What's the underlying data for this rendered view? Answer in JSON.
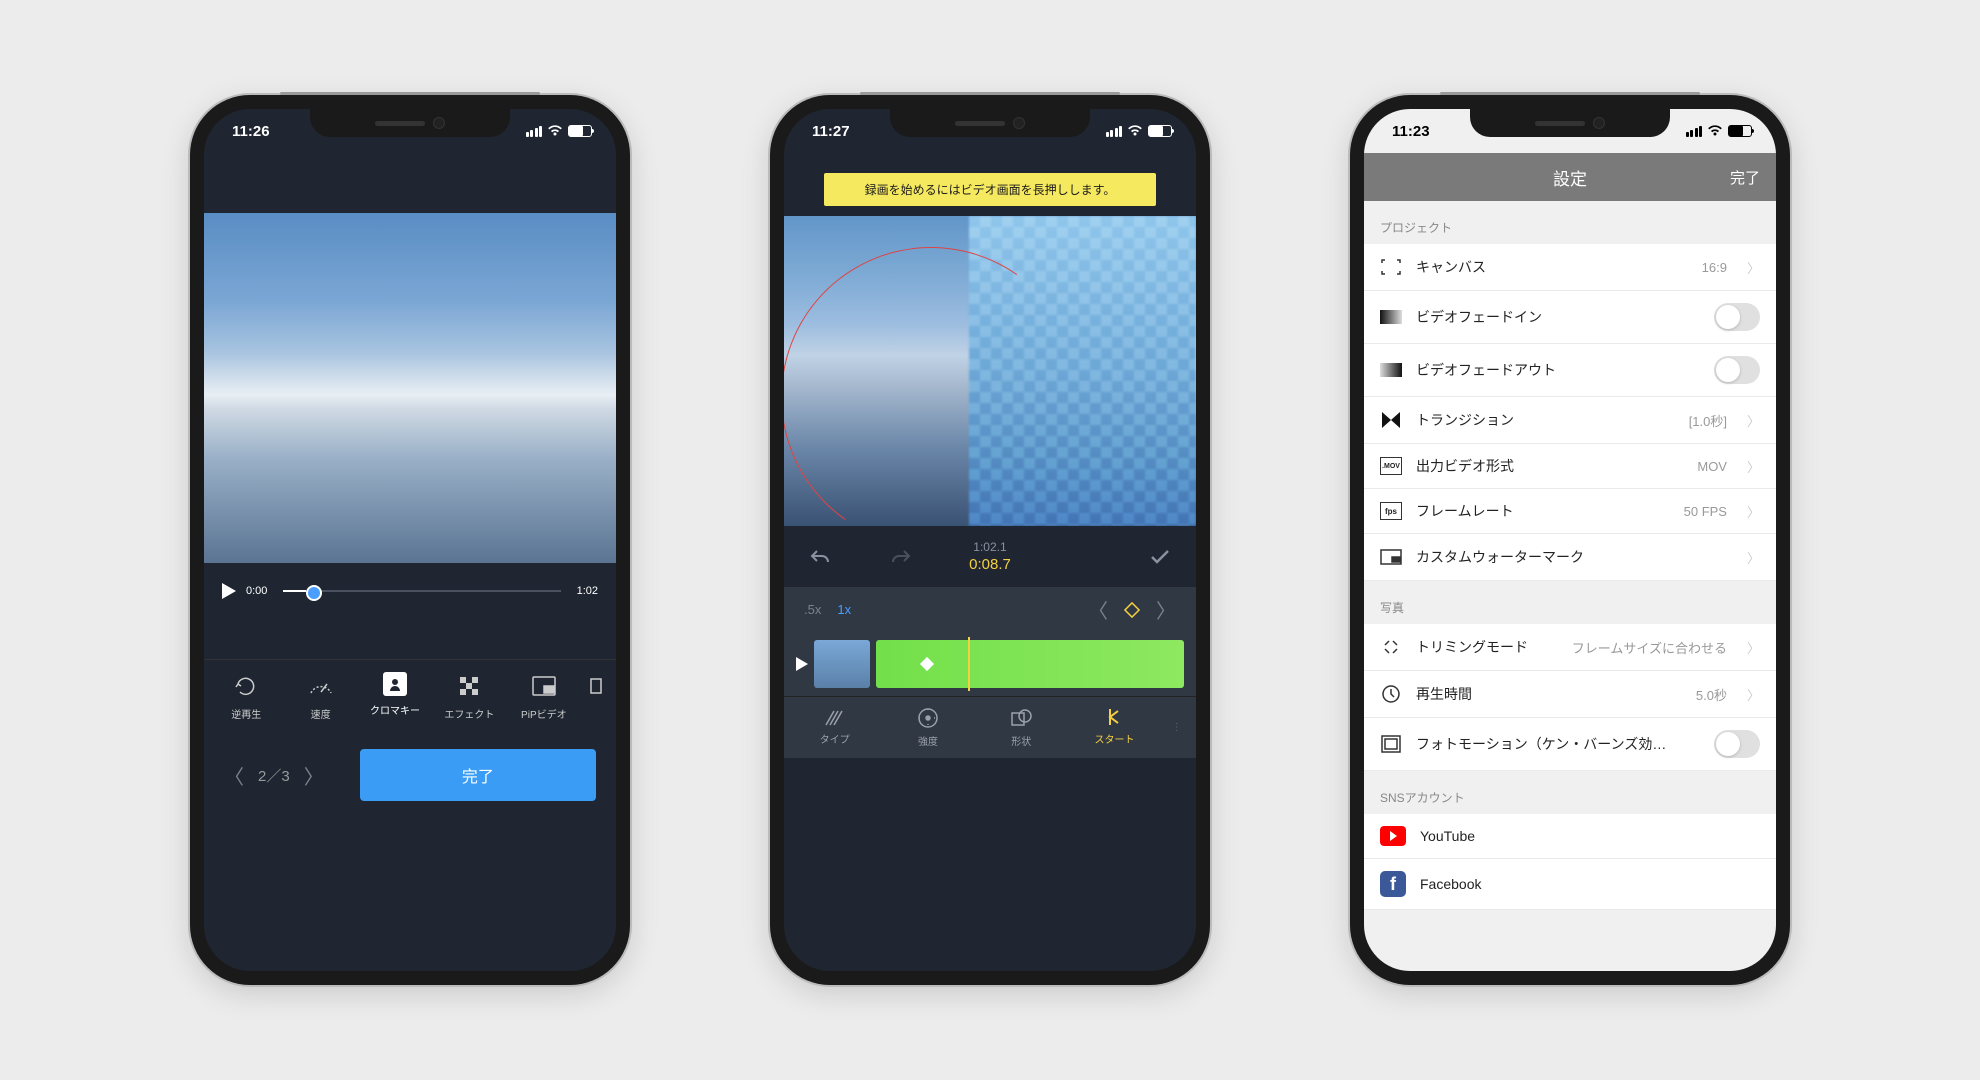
{
  "phone1": {
    "time": "11:26",
    "playback": {
      "current": "0:00",
      "total": "1:02"
    },
    "tools": [
      "逆再生",
      "速度",
      "クロマキー",
      "エフェクト",
      "PiPビデオ"
    ],
    "pager": "2／3",
    "done": "完了"
  },
  "phone2": {
    "time": "11:27",
    "hint": "録画を始めるにはビデオ画面を長押しします。",
    "total_time": "1:02.1",
    "current_time": "0:08.7",
    "zoom": [
      ".5x",
      "1x"
    ],
    "fx": [
      "タイプ",
      "強度",
      "形状",
      "スタート"
    ]
  },
  "phone3": {
    "time": "11:23",
    "title": "設定",
    "done": "完了",
    "sections": {
      "project_h": "プロジェクト",
      "photo_h": "写真",
      "sns_h": "SNSアカウント"
    },
    "rows": {
      "canvas": {
        "label": "キャンバス",
        "val": "16:9"
      },
      "fadein": {
        "label": "ビデオフェードイン"
      },
      "fadeout": {
        "label": "ビデオフェードアウト"
      },
      "transition": {
        "label": "トランジション",
        "val": "[1.0秒]"
      },
      "format": {
        "label": "出力ビデオ形式",
        "val": "MOV"
      },
      "fps": {
        "label": "フレームレート",
        "val": "50 FPS"
      },
      "watermark": {
        "label": "カスタムウォーターマーク"
      },
      "trim": {
        "label": "トリミングモード",
        "val": "フレームサイズに合わせる"
      },
      "duration": {
        "label": "再生時間",
        "val": "5.0秒"
      },
      "kenburns": {
        "label": "フォトモーション（ケン・バーンズ効…"
      },
      "youtube": {
        "label": "YouTube"
      },
      "facebook": {
        "label": "Facebook"
      }
    }
  }
}
